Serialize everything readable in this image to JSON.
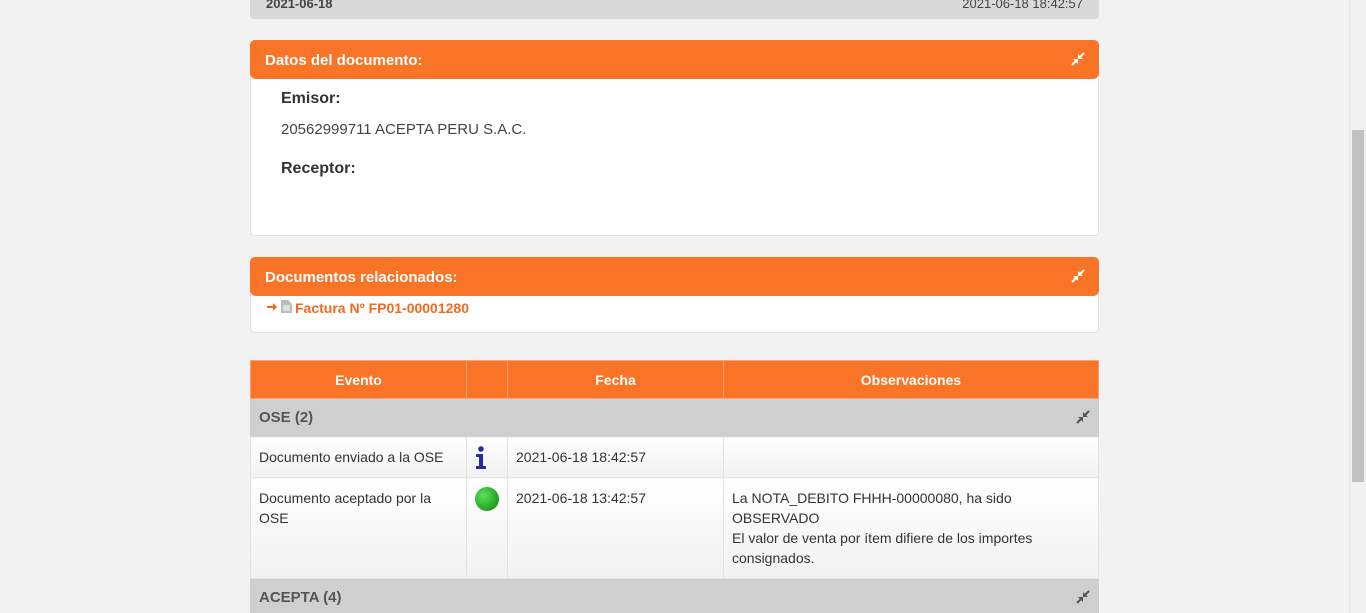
{
  "top_strip": {
    "left": "2021-06-18",
    "right": "2021-06-18 18:42:57"
  },
  "document_panel": {
    "title": "Datos del documento:",
    "emisor_label": "Emisor:",
    "emisor_value": "20562999711 ACEPTA PERU S.A.C.",
    "receptor_label": "Receptor:"
  },
  "related_panel": {
    "title": "Documentos relacionados:",
    "link_text": "Factura Nº FP01-00001280"
  },
  "events_table": {
    "headers": [
      "Evento",
      "",
      "Fecha",
      "Observaciones"
    ],
    "groups": [
      {
        "name": "OSE (2)",
        "rows": [
          {
            "evento": "Documento enviado a la OSE",
            "icon": "info-icon",
            "fecha": "2021-06-18 18:42:57",
            "obs": ""
          },
          {
            "evento": "Documento aceptado por la OSE",
            "icon": "green-status-icon",
            "fecha": "2021-06-18 13:42:57",
            "obs_line1": "La NOTA_DEBITO FHHH-00000080, ha sido OBSERVADO",
            "obs_line2": "El valor de venta por ítem difiere de los importes consignados."
          }
        ]
      },
      {
        "name": "ACEPTA (4)"
      }
    ]
  },
  "colors": {
    "accent": "#f97427",
    "group_bg": "#cfcfcf",
    "link": "#f26a1f"
  }
}
